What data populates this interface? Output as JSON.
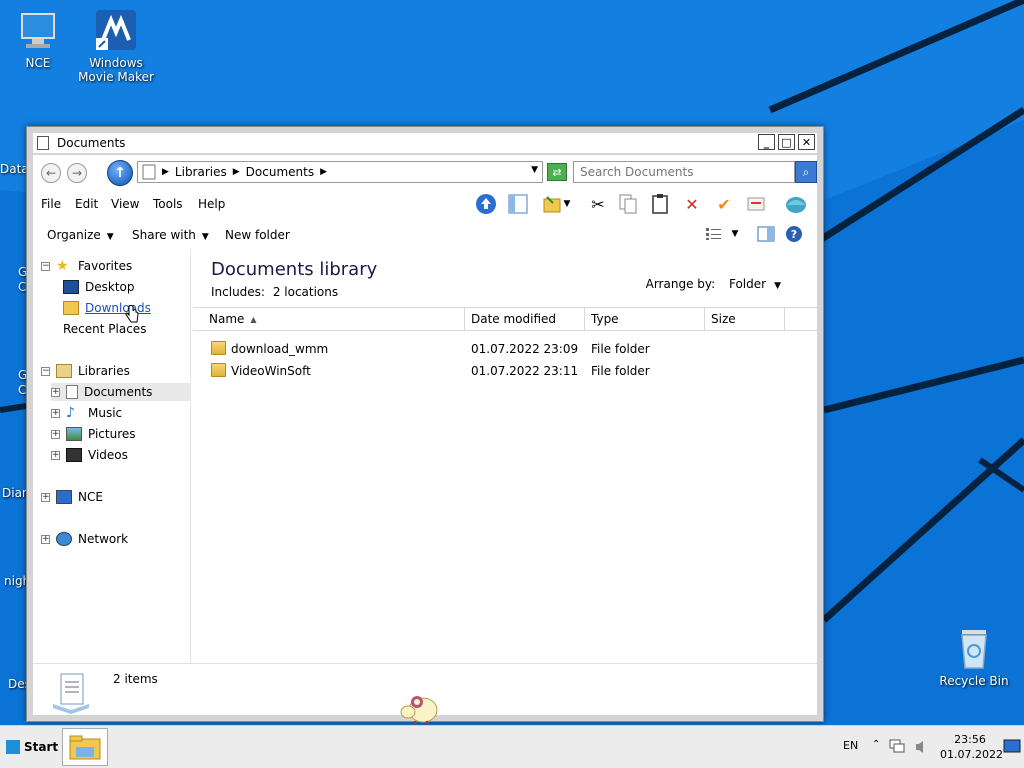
{
  "desktop": {
    "icons": [
      {
        "label_line1": "NCE",
        "label_line2": ""
      },
      {
        "label_line1": "Windows",
        "label_line2": "Movie Maker"
      },
      {
        "label_line1": "Recycle Bin",
        "label_line2": ""
      }
    ],
    "partial_labels": [
      "Data",
      "G",
      "C",
      "G",
      "C",
      "Diar",
      "nigh",
      "Des"
    ]
  },
  "window": {
    "title": "Documents",
    "buttons": {
      "minimize": "_",
      "maximize": "□",
      "close": "✕"
    }
  },
  "address": {
    "crumbs": [
      "Libraries",
      "Documents"
    ],
    "search_placeholder": "Search Documents"
  },
  "menu": [
    "File",
    "Edit",
    "View",
    "Tools",
    "Help"
  ],
  "commands": {
    "organize": "Organize",
    "share_with": "Share with",
    "new_folder": "New folder"
  },
  "nav": {
    "favorites": "Favorites",
    "desktop": "Desktop",
    "downloads": "Downloads",
    "recent_places": "Recent Places",
    "libraries": "Libraries",
    "documents": "Documents",
    "music": "Music",
    "pictures": "Pictures",
    "videos": "Videos",
    "nce": "NCE",
    "network": "Network"
  },
  "library": {
    "title": "Documents library",
    "includes_label": "Includes:",
    "includes_value": "2 locations",
    "arrange_label": "Arrange by:",
    "arrange_value": "Folder"
  },
  "columns": {
    "name": "Name",
    "date": "Date modified",
    "type": "Type",
    "size": "Size"
  },
  "files": [
    {
      "name": "download_wmm",
      "date": "01.07.2022 23:09",
      "type": "File folder",
      "size": ""
    },
    {
      "name": "VideoWinSoft",
      "date": "01.07.2022 23:11",
      "type": "File folder",
      "size": ""
    }
  ],
  "status": {
    "count": "2 items"
  },
  "taskbar": {
    "start": "Start",
    "lang": "EN",
    "time": "23:56",
    "date": "01.07.2022"
  }
}
